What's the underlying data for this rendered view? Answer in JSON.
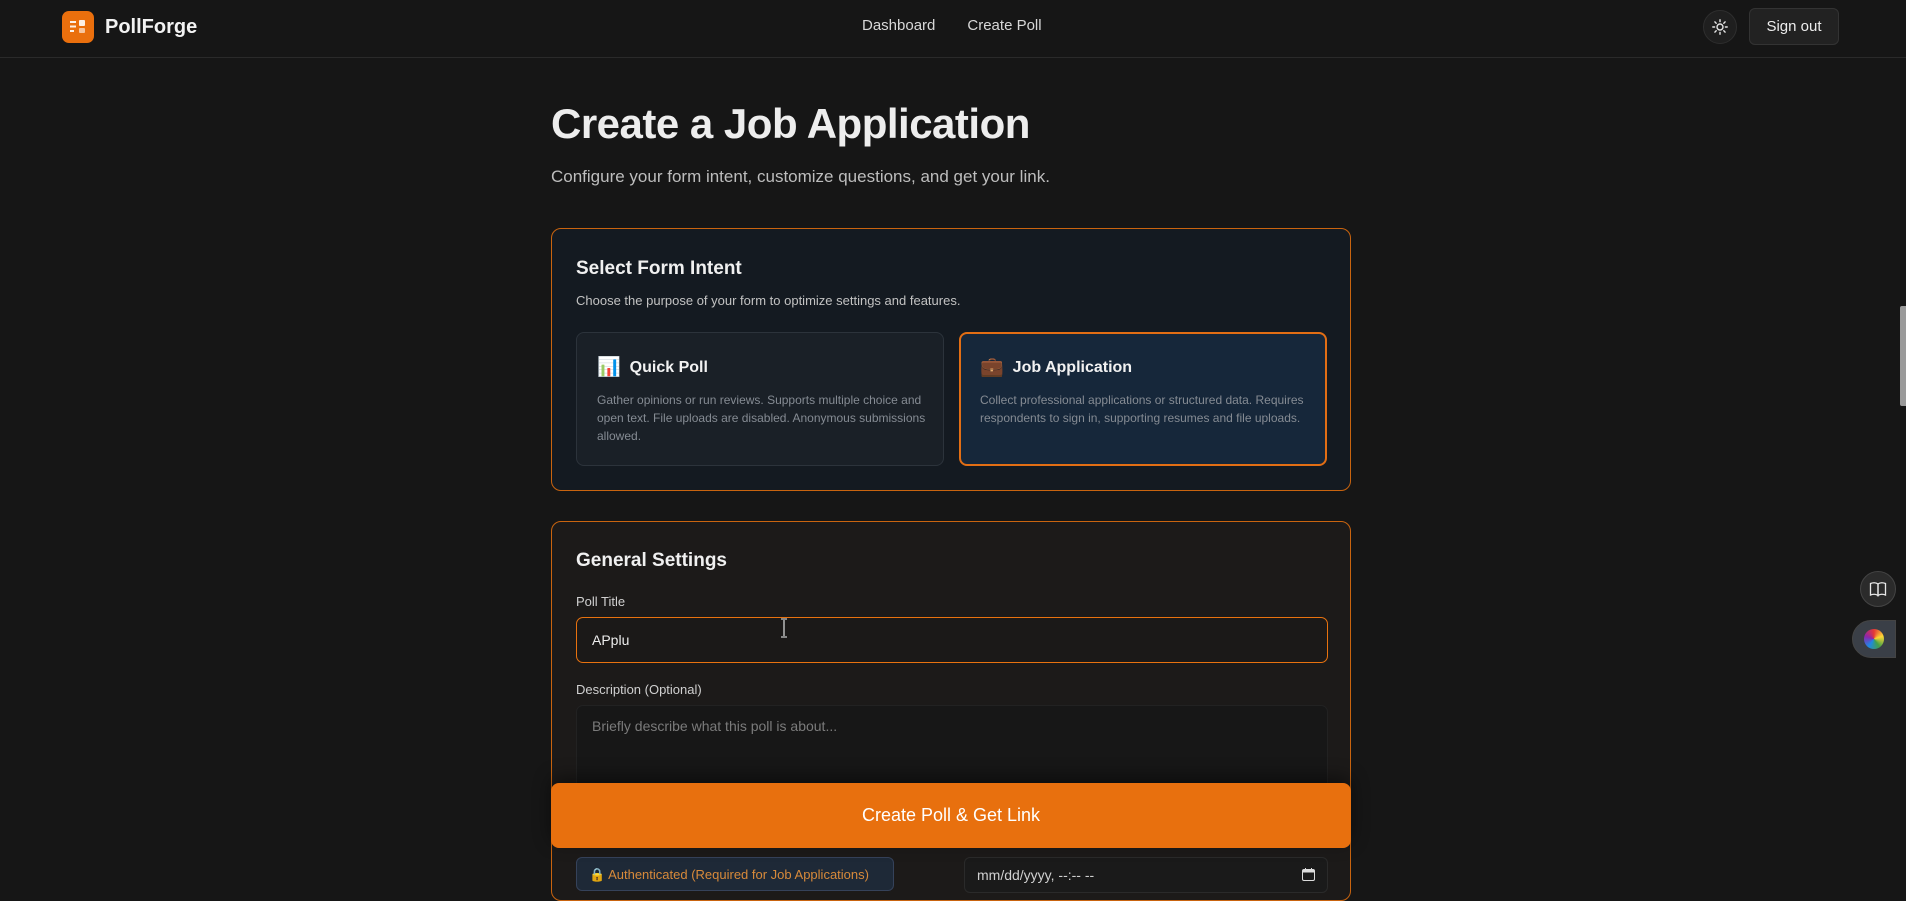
{
  "header": {
    "brand_name": "PollForge",
    "nav": [
      "Dashboard",
      "Create Poll"
    ],
    "theme_icon": "sun-icon",
    "signout_label": "Sign out"
  },
  "page": {
    "title": "Create a Job Application",
    "subtitle": "Configure your form intent, customize questions, and get your link."
  },
  "intent": {
    "title": "Select Form Intent",
    "description": "Choose the purpose of your form to optimize settings and features.",
    "options": [
      {
        "icon": "bar-chart-icon",
        "glyph": "📊",
        "title": "Quick Poll",
        "description": "Gather opinions or run reviews. Supports multiple choice and open text. File uploads are disabled. Anonymous submissions allowed.",
        "selected": false
      },
      {
        "icon": "briefcase-icon",
        "glyph": "💼",
        "title": "Job Application",
        "description": "Collect professional applications or structured data. Requires respondents to sign in, supporting resumes and file uploads.",
        "selected": true
      }
    ]
  },
  "settings": {
    "title": "General Settings",
    "poll_title_label": "Poll Title",
    "poll_title_value": "APplu",
    "description_label": "Description (Optional)",
    "description_placeholder": "Briefly describe what this poll is about...",
    "auth_badge": "🔒 Authenticated (Required for Job Applications)",
    "date_placeholder": "mm/dd/yyyy, --:-- --"
  },
  "actions": {
    "create_label": "Create Poll & Get Link"
  },
  "colors": {
    "accent": "#e8700e",
    "background": "#161616",
    "selected_card_bg": "#16273a"
  }
}
